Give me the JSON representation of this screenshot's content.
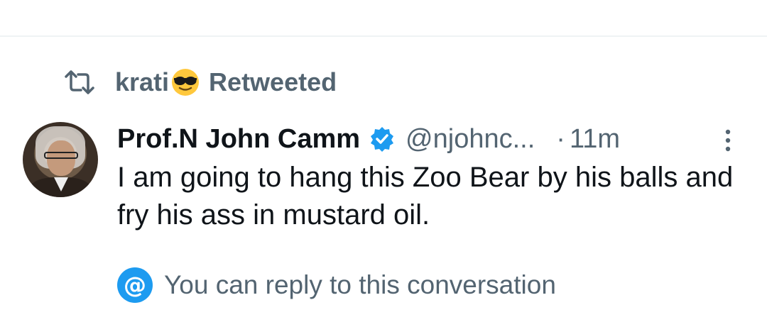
{
  "retweet": {
    "user": "krati",
    "emoji": "smiling-face-with-sunglasses",
    "suffix": "Retweeted"
  },
  "tweet": {
    "author_name": "Prof.N John Camm",
    "handle": "@njohnc...",
    "separator": "·",
    "time": "11m",
    "text": "I am going to hang this Zoo Bear by his balls and fry his ass in mustard oil.",
    "verified": true
  },
  "reply_notice": {
    "icon": "at-icon",
    "text": "You can reply to this conversation"
  },
  "colors": {
    "accent": "#1d9bf0",
    "secondary_text": "#536471",
    "primary_text": "#0f1419"
  }
}
